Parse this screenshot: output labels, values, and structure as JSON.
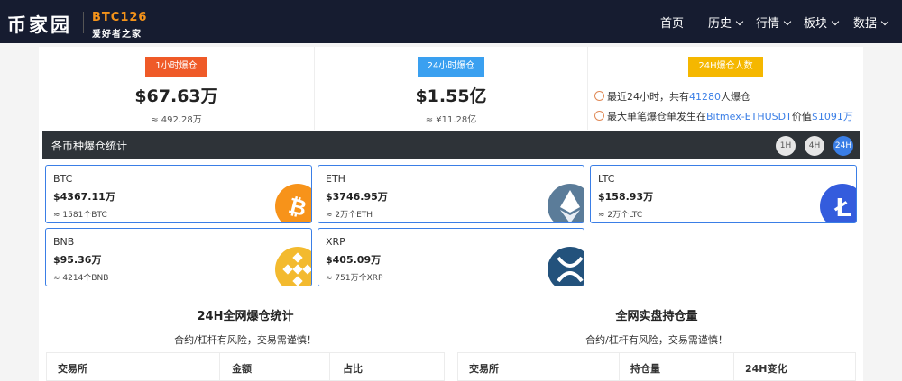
{
  "nav": {
    "logo_cn": "币家园",
    "logo_en": "BTC126",
    "logo_sub": "爱好者之家",
    "items": [
      {
        "label": "首页",
        "dropdown": false
      },
      {
        "label": "历史",
        "dropdown": true
      },
      {
        "label": "行情",
        "dropdown": true
      },
      {
        "label": "板块",
        "dropdown": true
      },
      {
        "label": "数据",
        "dropdown": true
      }
    ]
  },
  "stats": {
    "hour1": {
      "tag": "1小时爆仓",
      "tag_color": "#ef5a28",
      "value": "$67.63万",
      "sub": "≈ 492.28万"
    },
    "hour24": {
      "tag": "24小时爆仓",
      "tag_color": "#3aa0f0",
      "value": "$1.55亿",
      "sub": "≈ ¥11.28亿"
    },
    "people": {
      "tag": "24H爆仓人数",
      "tag_color": "#f5b700",
      "line1_pre": "最近24小时，共有",
      "line1_count": "41280",
      "line1_post": "人爆仓",
      "line2_pre": "最大单笔爆仓单发生在",
      "line2_pair": "Bitmex-ETHUSDT",
      "line2_mid": "价值",
      "line2_value": "$1091万"
    }
  },
  "coin_section": {
    "title": "各币种爆仓统计",
    "periods": [
      "1H",
      "4H",
      "24H"
    ],
    "active_period": "24H"
  },
  "coins": [
    {
      "symbol": "BTC",
      "value": "$4367.11万",
      "sub": "≈ 1581个BTC",
      "icon": "bitcoin-icon",
      "color": "#f7931a"
    },
    {
      "symbol": "ETH",
      "value": "$3746.95万",
      "sub": "≈ 2万个ETH",
      "icon": "ethereum-icon",
      "color": "#5b7c99"
    },
    {
      "symbol": "LTC",
      "value": "$158.93万",
      "sub": "≈ 2万个LTC",
      "icon": "litecoin-icon",
      "color": "#345cdd"
    },
    {
      "symbol": "BNB",
      "value": "$95.36万",
      "sub": "≈ 4214个BNB",
      "icon": "bnb-icon",
      "color": "#f3ba2f"
    },
    {
      "symbol": "XRP",
      "value": "$405.09万",
      "sub": "≈ 751万个XRP",
      "icon": "xrp-icon",
      "color": "#23527c"
    }
  ],
  "panel_left": {
    "title": "24H全网爆仓统计",
    "note": "合约/杠杆有风险，交易需谨慎！",
    "columns": [
      "交易所",
      "金额",
      "占比"
    ]
  },
  "panel_right": {
    "title": "全网实盘持仓量",
    "note": "合约/杠杆有风险，交易需谨慎！",
    "columns": [
      "交易所",
      "持仓量",
      "24H变化"
    ]
  }
}
